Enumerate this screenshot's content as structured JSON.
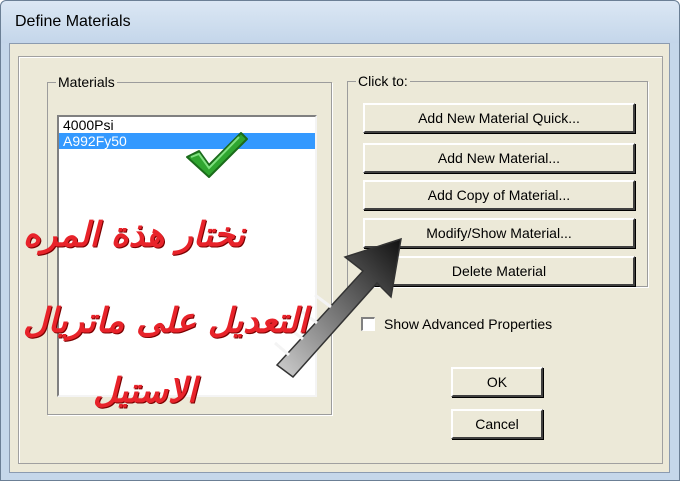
{
  "window": {
    "title": "Define Materials"
  },
  "materials_group": {
    "label": "Materials",
    "items": [
      "4000Psi",
      "A992Fy50"
    ],
    "selected_index": 1
  },
  "actions_group": {
    "label": "Click to:",
    "buttons": [
      "Add New Material Quick...",
      "Add New Material...",
      "Add Copy of Material...",
      "Modify/Show Material...",
      "Delete Material"
    ]
  },
  "advanced": {
    "label": "Show Advanced Properties",
    "checked": false
  },
  "footer": {
    "ok": "OK",
    "cancel": "Cancel"
  },
  "annotation": {
    "line1": "نختار هذة المره",
    "line2": "التعديل على ماتريال",
    "line3": "الاستيل",
    "text_color": "#e8232a",
    "checkmark_color": "#2fa52f",
    "icons": [
      "green-checkmark-icon",
      "pointer-arrow-icon"
    ]
  }
}
